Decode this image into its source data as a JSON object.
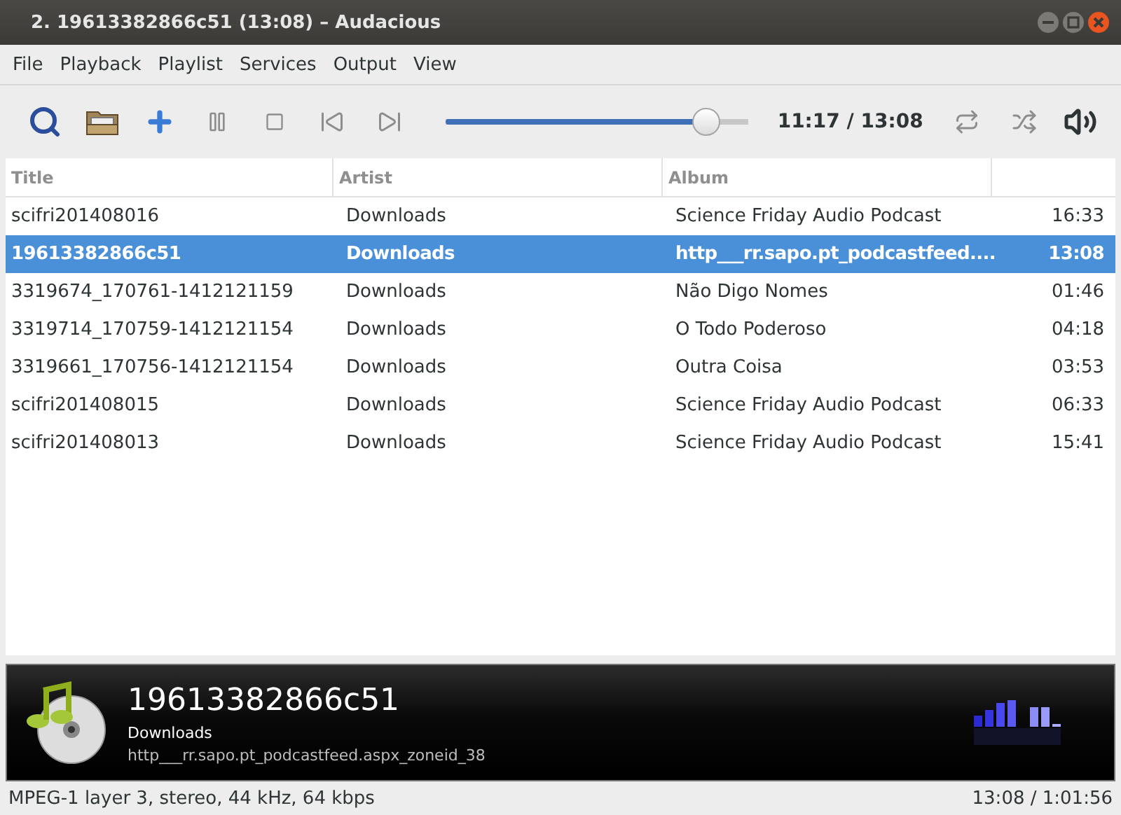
{
  "window": {
    "title": "2. 19613382866c51 (13:08) – Audacious"
  },
  "menu": [
    "File",
    "Playback",
    "Playlist",
    "Services",
    "Output",
    "View"
  ],
  "toolbar": {
    "seek": {
      "level": 0.86
    },
    "time": "11:17 / 13:08",
    "repeat": {
      "on": false
    },
    "shuffle": {
      "on": false
    }
  },
  "playlist": {
    "columns": [
      "Title",
      "Artist",
      "Album"
    ],
    "rows": [
      {
        "title": "scifri201408016",
        "artist": "Downloads",
        "album": "Science Friday Audio Podcast",
        "length": "16:33",
        "selected": false
      },
      {
        "title": "19613382866c51",
        "artist": "Downloads",
        "album": "http___rr.sapo.pt_podcastfeed....",
        "length": "13:08",
        "selected": true
      },
      {
        "title": "3319674_170761-1412121159",
        "artist": "Downloads",
        "album": "Não Digo Nomes",
        "length": "01:46",
        "selected": false
      },
      {
        "title": "3319714_170759-1412121154",
        "artist": "Downloads",
        "album": "O Todo Poderoso",
        "length": "04:18",
        "selected": false
      },
      {
        "title": "3319661_170756-1412121154",
        "artist": "Downloads",
        "album": "Outra Coisa",
        "length": "03:53",
        "selected": false
      },
      {
        "title": "scifri201408015",
        "artist": "Downloads",
        "album": "Science Friday Audio Podcast",
        "length": "06:33",
        "selected": false
      },
      {
        "title": "scifri201408013",
        "artist": "Downloads",
        "album": "Science Friday Audio Podcast",
        "length": "15:41",
        "selected": false
      }
    ]
  },
  "now_playing": {
    "title": "19613382866c51",
    "artist": "Downloads",
    "album": "http___rr.sapo.pt_podcastfeed.aspx_zoneid_38"
  },
  "status_bar": {
    "format": "MPEG-1 layer 3, stereo, 44 kHz, 64 kbps",
    "time": "13:08 / 1:01:56"
  }
}
